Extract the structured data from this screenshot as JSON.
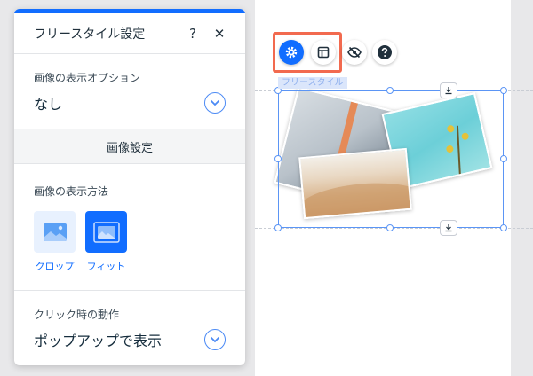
{
  "panel": {
    "title": "フリースタイル設定",
    "help_label": "?",
    "close_label": "✕",
    "display_option": {
      "label": "画像の表示オプション",
      "value": "なし"
    },
    "image_settings_band": "画像設定",
    "display_method": {
      "label": "画像の表示方法",
      "options": [
        {
          "label": "クロップ",
          "selected": false
        },
        {
          "label": "フィット",
          "selected": true
        }
      ]
    },
    "click_action": {
      "label": "クリック時の動作",
      "value": "ポップアップで表示"
    }
  },
  "canvas": {
    "selection_label": "フリースタイル",
    "toolbar": [
      "gear-icon",
      "layout-icon",
      "hide-icon",
      "help-icon"
    ]
  },
  "colors": {
    "accent": "#116dff",
    "highlight": "#f26a4f",
    "selection": "#5b95f5"
  }
}
